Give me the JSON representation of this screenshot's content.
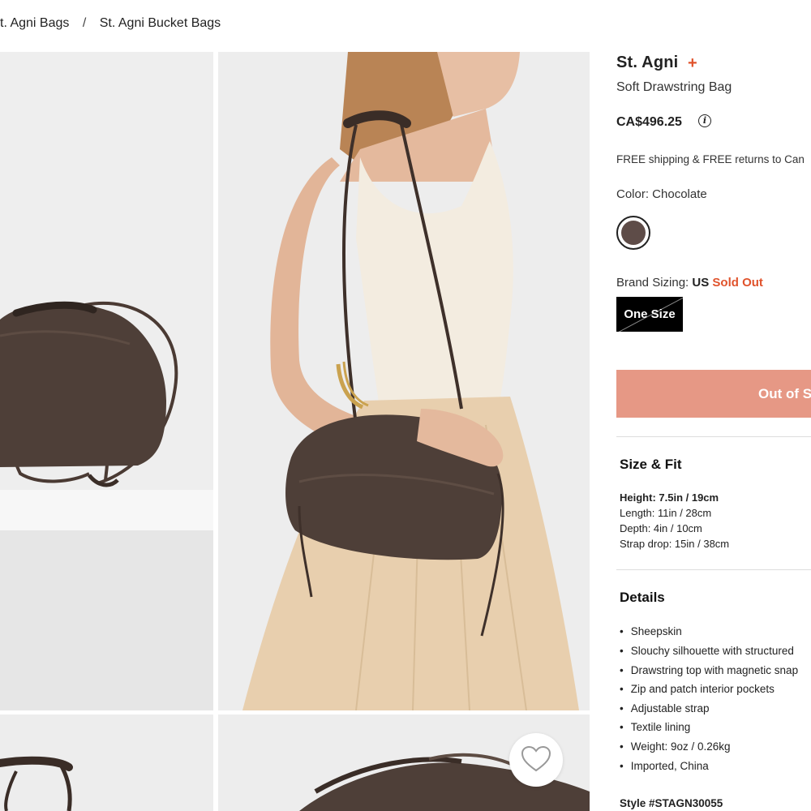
{
  "breadcrumb": {
    "items": [
      "t. Agni Bags",
      "St. Agni Bucket Bags"
    ],
    "separator": "/"
  },
  "product": {
    "brand": "St. Agni",
    "brand_plus": "+",
    "name": "Soft Drawstring Bag",
    "price": "CA$496.25",
    "info_icon_glyph": "i",
    "shipping": "FREE shipping & FREE returns to Can",
    "color_label": "Color: Chocolate",
    "color_swatch": "#5e4c48",
    "sizing_prefix": "Brand Sizing:",
    "sizing_region": "US",
    "sizing_status": "Sold Out",
    "size_option": "One Size",
    "oos_button": "Out of S"
  },
  "size_fit": {
    "title": "Size & Fit",
    "lines": [
      "Height: 7.5in / 19cm",
      "Length: 11in / 28cm",
      "Depth: 4in / 10cm",
      "Strap drop: 15in / 38cm"
    ]
  },
  "details": {
    "title": "Details",
    "bullets": [
      "Sheepskin",
      "Slouchy silhouette with structured",
      "Drawstring top with magnetic snap",
      "Zip and patch interior pockets",
      "Adjustable strap",
      "Textile lining",
      "Weight: 9oz / 0.26kg",
      "Imported, China"
    ]
  },
  "style_number": "Style #STAGN30055",
  "colors": {
    "accent": "#e0532c",
    "oos_button_bg": "#e69885",
    "bag_brown": "#4e3f38"
  },
  "icons": {
    "wishlist": "heart-icon",
    "info": "info-icon"
  }
}
